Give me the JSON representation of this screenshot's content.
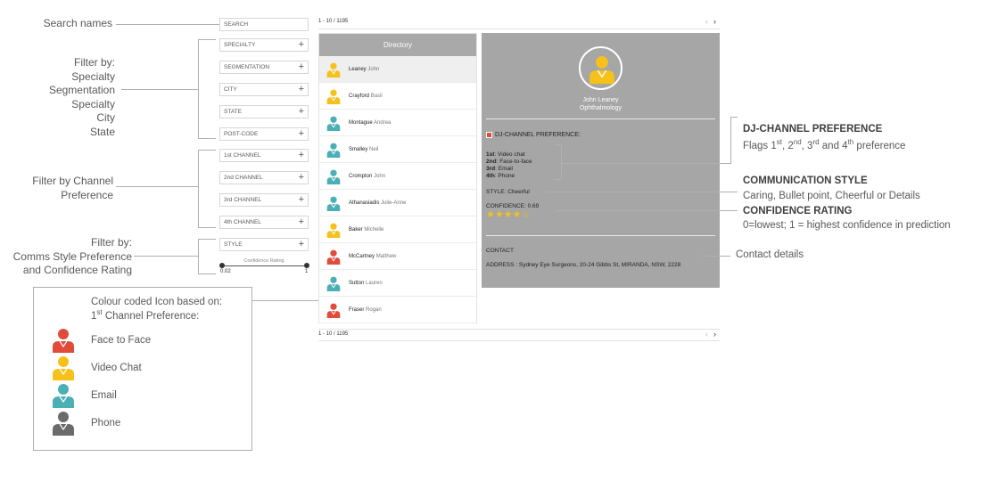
{
  "left_annotations": {
    "search": "Search names",
    "filter_lines": [
      "Filter by:",
      "Specialty",
      "Segmentation",
      "Specialty",
      "City",
      "State"
    ],
    "channel_lines": [
      "Filter by Channel",
      "Preference"
    ],
    "comms_lines": [
      "Filter by:",
      "Comms Style Preference",
      "and Confidence Rating"
    ]
  },
  "filters": {
    "search_placeholder": "SEARCH",
    "items": [
      {
        "label": "SPECIALTY"
      },
      {
        "label": "SEGMENTATION"
      },
      {
        "label": "CITY"
      },
      {
        "label": "STATE"
      },
      {
        "label": "POST-CODE"
      },
      {
        "label": "1st CHANNEL"
      },
      {
        "label": "2nd CHANNEL"
      },
      {
        "label": "3rd CHANNEL"
      },
      {
        "label": "4th CHANNEL"
      },
      {
        "label": "STYLE"
      }
    ],
    "plus": "+",
    "slider_label": "Confidence Rating",
    "slider_min": "0.02",
    "slider_max": "1"
  },
  "legend": {
    "title_line1": "Colour coded Icon based on:",
    "title_line2_pre": "1",
    "title_line2_sup": "st",
    "title_line2_post": " Channel Preference:",
    "items": [
      {
        "label": "Face to Face",
        "icon": "doctor-icon",
        "color": "#e04b3a"
      },
      {
        "label": "Video Chat",
        "icon": "doctor-icon",
        "color": "#f5c11a"
      },
      {
        "label": "Email",
        "icon": "doctor-icon",
        "color": "#4ab0b5"
      },
      {
        "label": "Phone",
        "icon": "doctor-icon",
        "color": "#6b6b6b"
      }
    ]
  },
  "directory": {
    "pager": "1 - 10 / 1195",
    "prev": "‹",
    "next": "›",
    "header": "Directory",
    "rows": [
      {
        "last": "Leaney",
        "first": "John",
        "color": "#f5c11a"
      },
      {
        "last": "Crayford",
        "first": "Basil",
        "color": "#f5c11a"
      },
      {
        "last": "Montague",
        "first": "Andrea",
        "color": "#4ab0b5"
      },
      {
        "last": "Smalley",
        "first": "Neil",
        "color": "#4ab0b5"
      },
      {
        "last": "Crompton",
        "first": "John",
        "color": "#4ab0b5"
      },
      {
        "last": "Athanasiadis",
        "first": "Julie-Anne",
        "color": "#4ab0b5"
      },
      {
        "last": "Baker",
        "first": "Michelle",
        "color": "#f5c11a"
      },
      {
        "last": "McCartney",
        "first": "Matthew",
        "color": "#e04b3a"
      },
      {
        "last": "Sutton",
        "first": "Lauren",
        "color": "#4ab0b5"
      },
      {
        "last": "Fraser",
        "first": "Rogan",
        "color": "#e04b3a"
      }
    ]
  },
  "detail": {
    "name": "John Leaney",
    "specialty": "Ophthalmology",
    "avatar_color": "#f5c11a",
    "dj_label": "DJ-CHANNEL PREFERENCE:",
    "prefs": [
      {
        "rank": "1st",
        "value": "Video chat"
      },
      {
        "rank": "2nd",
        "value": "Face-to-face"
      },
      {
        "rank": "3rd",
        "value": "Email"
      },
      {
        "rank": "4th",
        "value": "Phone"
      }
    ],
    "style_key": "STYLE",
    "style_value": "Cheerful",
    "confidence_key": "CONFIDENCE",
    "confidence_value": "0.69",
    "stars_rating": 4,
    "stars_total": 5,
    "contact_label": "CONTACT",
    "address_key": "ADDRESS",
    "address_value": "Sydney Eye Surgeons, 20-24 Gibbs St, MIRANDA, NSW, 2228"
  },
  "right_annotations": {
    "dj_title": "DJ-CHANNEL PREFERENCE",
    "dj_desc_parts": [
      "Flags 1",
      "st",
      ", 2",
      "nd",
      ", 3",
      "rd",
      " and 4",
      "th",
      " preference"
    ],
    "comm_title": "COMMUNICATION STYLE",
    "comm_desc": "Caring, Bullet point, Cheerful or Details",
    "conf_title": "CONFIDENCE RATING",
    "conf_desc": "0=lowest; 1 = highest confidence in prediction",
    "contact": "Contact details"
  }
}
